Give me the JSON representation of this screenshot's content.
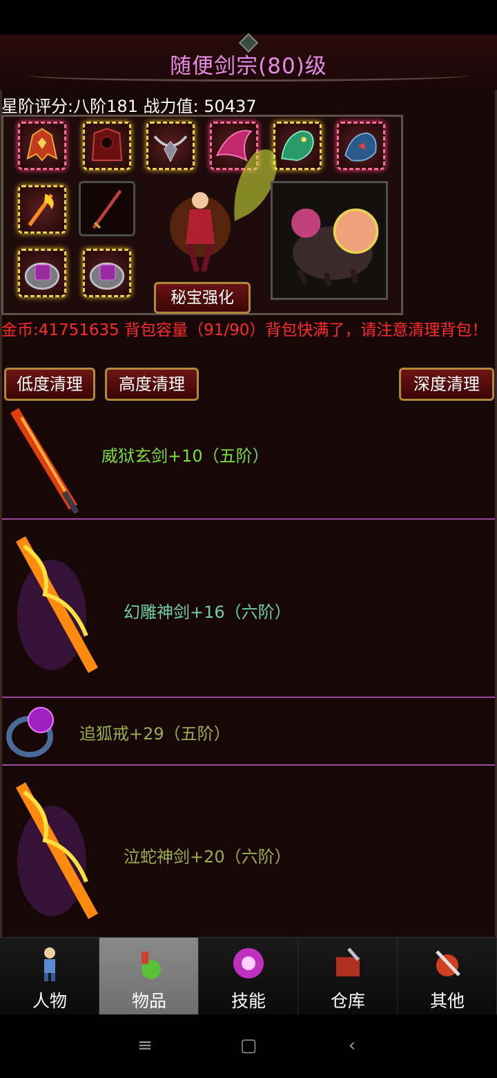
{
  "title": "随便剑宗(80)级",
  "score_line": "星阶评分:八阶181 战力值: 50437",
  "equip": {
    "slots": [
      {
        "name": "helmet-slot",
        "frame": "pink"
      },
      {
        "name": "armor-slot",
        "frame": "gold"
      },
      {
        "name": "necklace-slot",
        "frame": "gold"
      },
      {
        "name": "wing-slot",
        "frame": "pink"
      },
      {
        "name": "mount-slot",
        "frame": "gold"
      },
      {
        "name": "beast-slot",
        "frame": "pink"
      },
      {
        "name": "bracer-slot",
        "frame": "gold"
      },
      {
        "name": "weapon-slot",
        "frame": "dark"
      },
      {
        "name": "ring-left-slot",
        "frame": "gold"
      },
      {
        "name": "ring-right-slot",
        "frame": "gold"
      }
    ],
    "mibao_label": "秘宝强化"
  },
  "gold_line": "金币:41751635 背包容量（91/90）背包快满了，请注意清理背包！",
  "clean_buttons": {
    "low": "低度清理",
    "high": "高度清理",
    "deep": "深度清理"
  },
  "items": [
    {
      "name": "威狱玄剑+10（五阶）",
      "color": "#7ddc3c",
      "icon": "sword-icon"
    },
    {
      "name": "幻雕神剑+16（六阶）",
      "color": "#6fd0a6",
      "icon": "flame-sword-icon"
    },
    {
      "name": "追狐戒+29（五阶）",
      "color": "#9cae4e",
      "icon": "ring-icon"
    },
    {
      "name": "泣蛇神剑+20（六阶）",
      "color": "#9cae4e",
      "icon": "flame-sword-icon"
    }
  ],
  "tabs": [
    {
      "label": "人物",
      "icon": "character-icon"
    },
    {
      "label": "物品",
      "icon": "potion-icon",
      "active": true
    },
    {
      "label": "技能",
      "icon": "skill-orb-icon"
    },
    {
      "label": "仓库",
      "icon": "warehouse-icon"
    },
    {
      "label": "其他",
      "icon": "other-icon"
    }
  ],
  "nav": {
    "menu": "≡",
    "home": "▢",
    "back": "‹"
  }
}
